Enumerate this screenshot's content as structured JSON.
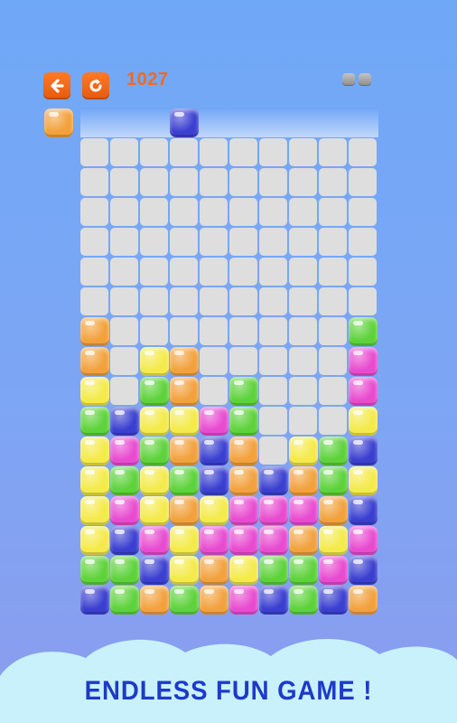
{
  "header": {
    "back_icon": "arrow-left-icon",
    "restart_icon": "restart-icon",
    "score": "1027",
    "pause_icon": "pause-icon"
  },
  "colors": {
    "orange": "#f2a13c",
    "blue": "#3a3fd0",
    "green": "#5dd23a",
    "yellow": "#f4ea4a",
    "magenta": "#e84bd0",
    "empty": "#dedede",
    "accent": "#f06a22",
    "tagline": "#1e3ac9"
  },
  "next_piece": {
    "color": "orange"
  },
  "falling_piece": {
    "color": "blue",
    "column": 3
  },
  "board": {
    "columns": 10,
    "rows": 16,
    "grid": [
      "..........",
      "..........",
      "..........",
      "..........",
      "..........",
      "..........",
      "O........G",
      "O.YO.....M",
      "Y.GO.G...M",
      "GBYYMG...Y",
      "YMGOBO.YGB",
      "YGYGBOBOGY",
      "YMYOYMMMOB",
      "YBMYMMMOYM",
      "GGBYOYGGMB",
      "BGOGOMBGBO"
    ],
    "legend": {
      "O": "orange",
      "B": "blue",
      "G": "green",
      "Y": "yellow",
      "M": "magenta",
      ".": "empty"
    }
  },
  "footer": {
    "tagline": "ENDLESS FUN GAME !"
  }
}
